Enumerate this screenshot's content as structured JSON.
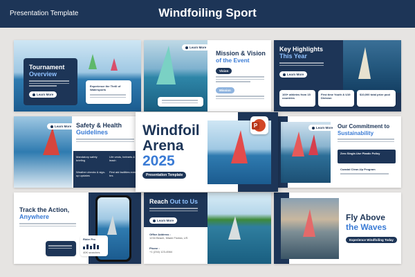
{
  "header": {
    "left_label": "Presentation Template",
    "title": "Windfoiling Sport"
  },
  "slides": {
    "tournament": {
      "title_line1": "Tournament",
      "title_line2": "Overview",
      "button": "Learn More",
      "card_text": "Experience the Thrill of Watersports"
    },
    "mission": {
      "button": "Learn More",
      "title_line1": "Mission & Vision",
      "title_line2": "of the Event",
      "vision_label": "Vision",
      "mission_label": "Mission"
    },
    "highlights": {
      "title_line1": "Key Highlights",
      "title_line2": "This Year",
      "button": "Learn More",
      "stat1": "100+ athletes from 15 countries",
      "stat2": "First time Youth & U19 Division",
      "stat3": "$10,000 total prize pool"
    },
    "safety": {
      "button": "Learn More",
      "title_line1": "Safety & Health",
      "title_line2": "Guidelines",
      "item1": "Mandatory safety briefing",
      "item2": "Life vests, helmets & leash",
      "item3": "Weather checks & sign-up updates",
      "item4": "First aid facilities every 2 hrs"
    },
    "cover": {
      "title_line1": "Windfoil",
      "title_line2": "Arena",
      "year": "2025",
      "subtitle": "Presentation Template"
    },
    "commitment": {
      "button": "Learn More",
      "title_line1": "Our Commitment to",
      "title_line2": "Sustainability",
      "item1": "Zero Single-Use Plastic Policy",
      "item2": "Coastal Clean-Up Program"
    },
    "track": {
      "title_line1": "Track the Action,",
      "title_line2": "Anywhere",
      "stat_label": "Rider Pro",
      "stat_value": "40K searches"
    },
    "reach": {
      "title_part1": "Reach",
      "title_part2": "Out to Us",
      "button": "Learn More",
      "office_label": "Office Address :",
      "office_value": "1234 Beach, Miami Florida, US",
      "phone_label": "Phone :",
      "phone_value": "+1 (234) 123-4564"
    },
    "fly": {
      "title_line1": "Fly Above",
      "title_line2": "the Waves",
      "button": "Experience Windfoiling Today"
    }
  },
  "colors": {
    "navy": "#1d3557",
    "accent_blue": "#3a7bd5",
    "canvas": "#e6e4e2",
    "powerpoint_orange": "#d24726"
  },
  "icons": [
    "powerpoint-icon"
  ]
}
